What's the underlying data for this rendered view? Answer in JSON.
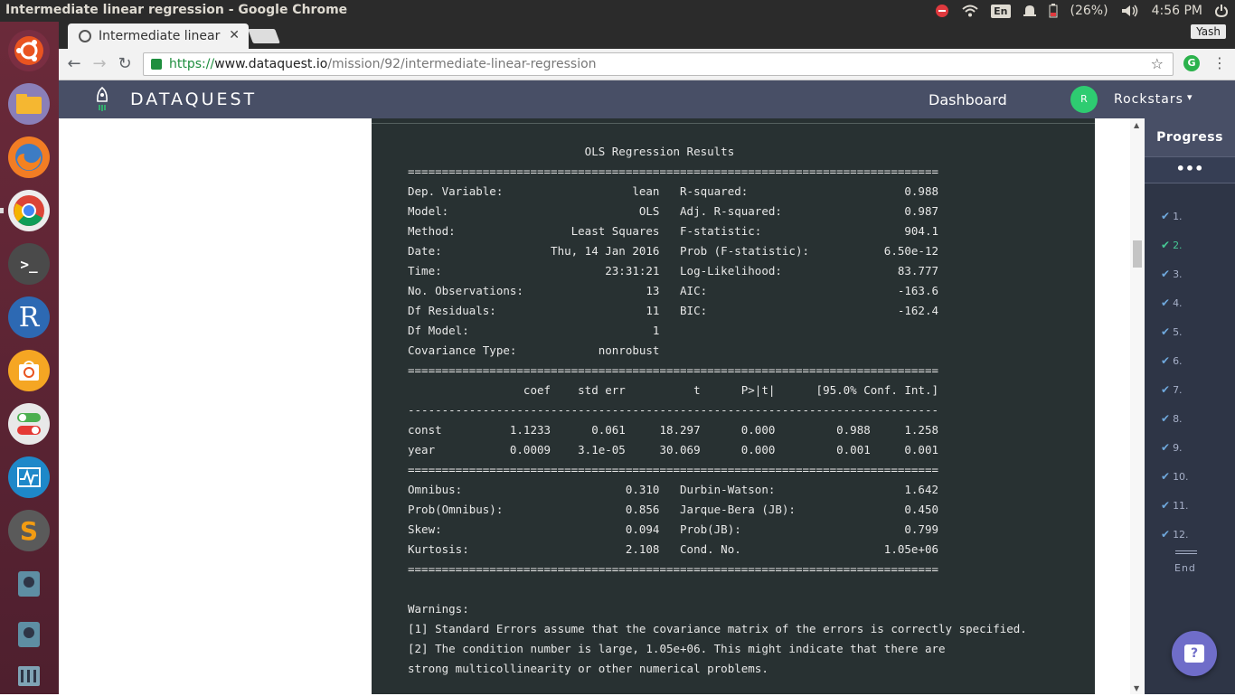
{
  "window": {
    "title": "Intermediate linear regression - Google Chrome"
  },
  "system_tray": {
    "language": "En",
    "battery": "(26%)",
    "time": "4:56 PM"
  },
  "launcher": {
    "apps": [
      "ubuntu-icon",
      "files-icon",
      "firefox-icon",
      "chrome-icon",
      "terminal-icon",
      "r-icon",
      "software-center-icon",
      "settings-toggle-icon",
      "system-monitor-icon",
      "sublime-icon",
      "app-icon",
      "app-icon",
      "app-icon"
    ]
  },
  "browser": {
    "tab_title": "Intermediate linear",
    "tab_close": "✕",
    "profile_name": "Yash",
    "url_protocol": "https://",
    "url_host": "www.dataquest.io",
    "url_path": "/mission/92/intermediate-linear-regression"
  },
  "dataquest": {
    "brand": "DATAQUEST",
    "nav_dashboard": "Dashboard",
    "avatar_letter": "R",
    "username": "Rockstars",
    "caret": "▾"
  },
  "output": {
    "text": "                          OLS Regression Results                            \n==============================================================================\nDep. Variable:                   lean   R-squared:                       0.988\nModel:                            OLS   Adj. R-squared:                  0.987\nMethod:                 Least Squares   F-statistic:                     904.1\nDate:                Thu, 14 Jan 2016   Prob (F-statistic):           6.50e-12\nTime:                        23:31:21   Log-Likelihood:                 83.777\nNo. Observations:                  13   AIC:                            -163.6\nDf Residuals:                      11   BIC:                            -162.4\nDf Model:                           1                                         \nCovariance Type:            nonrobust                                         \n==============================================================================\n                 coef    std err          t      P>|t|      [95.0% Conf. Int.]\n------------------------------------------------------------------------------\nconst          1.1233      0.061     18.297      0.000         0.988     1.258\nyear           0.0009    3.1e-05     30.069      0.000         0.001     0.001\n==============================================================================\nOmnibus:                        0.310   Durbin-Watson:                   1.642\nProb(Omnibus):                  0.856   Jarque-Bera (JB):                0.450\nSkew:                           0.094   Prob(JB):                        0.799\nKurtosis:                       2.108   Cond. No.                     1.05e+06\n==============================================================================\n\nWarnings:\n[1] Standard Errors assume that the covariance matrix of the errors is correctly specified.\n[2] The condition number is large, 1.05e+06. This might indicate that there are\nstrong multicollinearity or other numerical problems."
  },
  "progress": {
    "title": "Progress",
    "more": "•••",
    "items": [
      {
        "label": "1.",
        "done": true
      },
      {
        "label": "2.",
        "done": true
      },
      {
        "label": "3.",
        "done": true
      },
      {
        "label": "4.",
        "done": true
      },
      {
        "label": "5.",
        "done": true
      },
      {
        "label": "6.",
        "done": true
      },
      {
        "label": "7.",
        "done": true
      },
      {
        "label": "8.",
        "done": true
      },
      {
        "label": "9.",
        "done": true
      },
      {
        "label": "10.",
        "done": true
      },
      {
        "label": "11.",
        "done": true
      },
      {
        "label": "12.",
        "done": true
      }
    ],
    "active_index": 1,
    "end_label": "End"
  },
  "help": {
    "label": "?"
  },
  "colors": {
    "header": "#484f66",
    "output_bg": "#283132",
    "accent_green": "#46c794",
    "help_purple": "#6f6dc9"
  }
}
